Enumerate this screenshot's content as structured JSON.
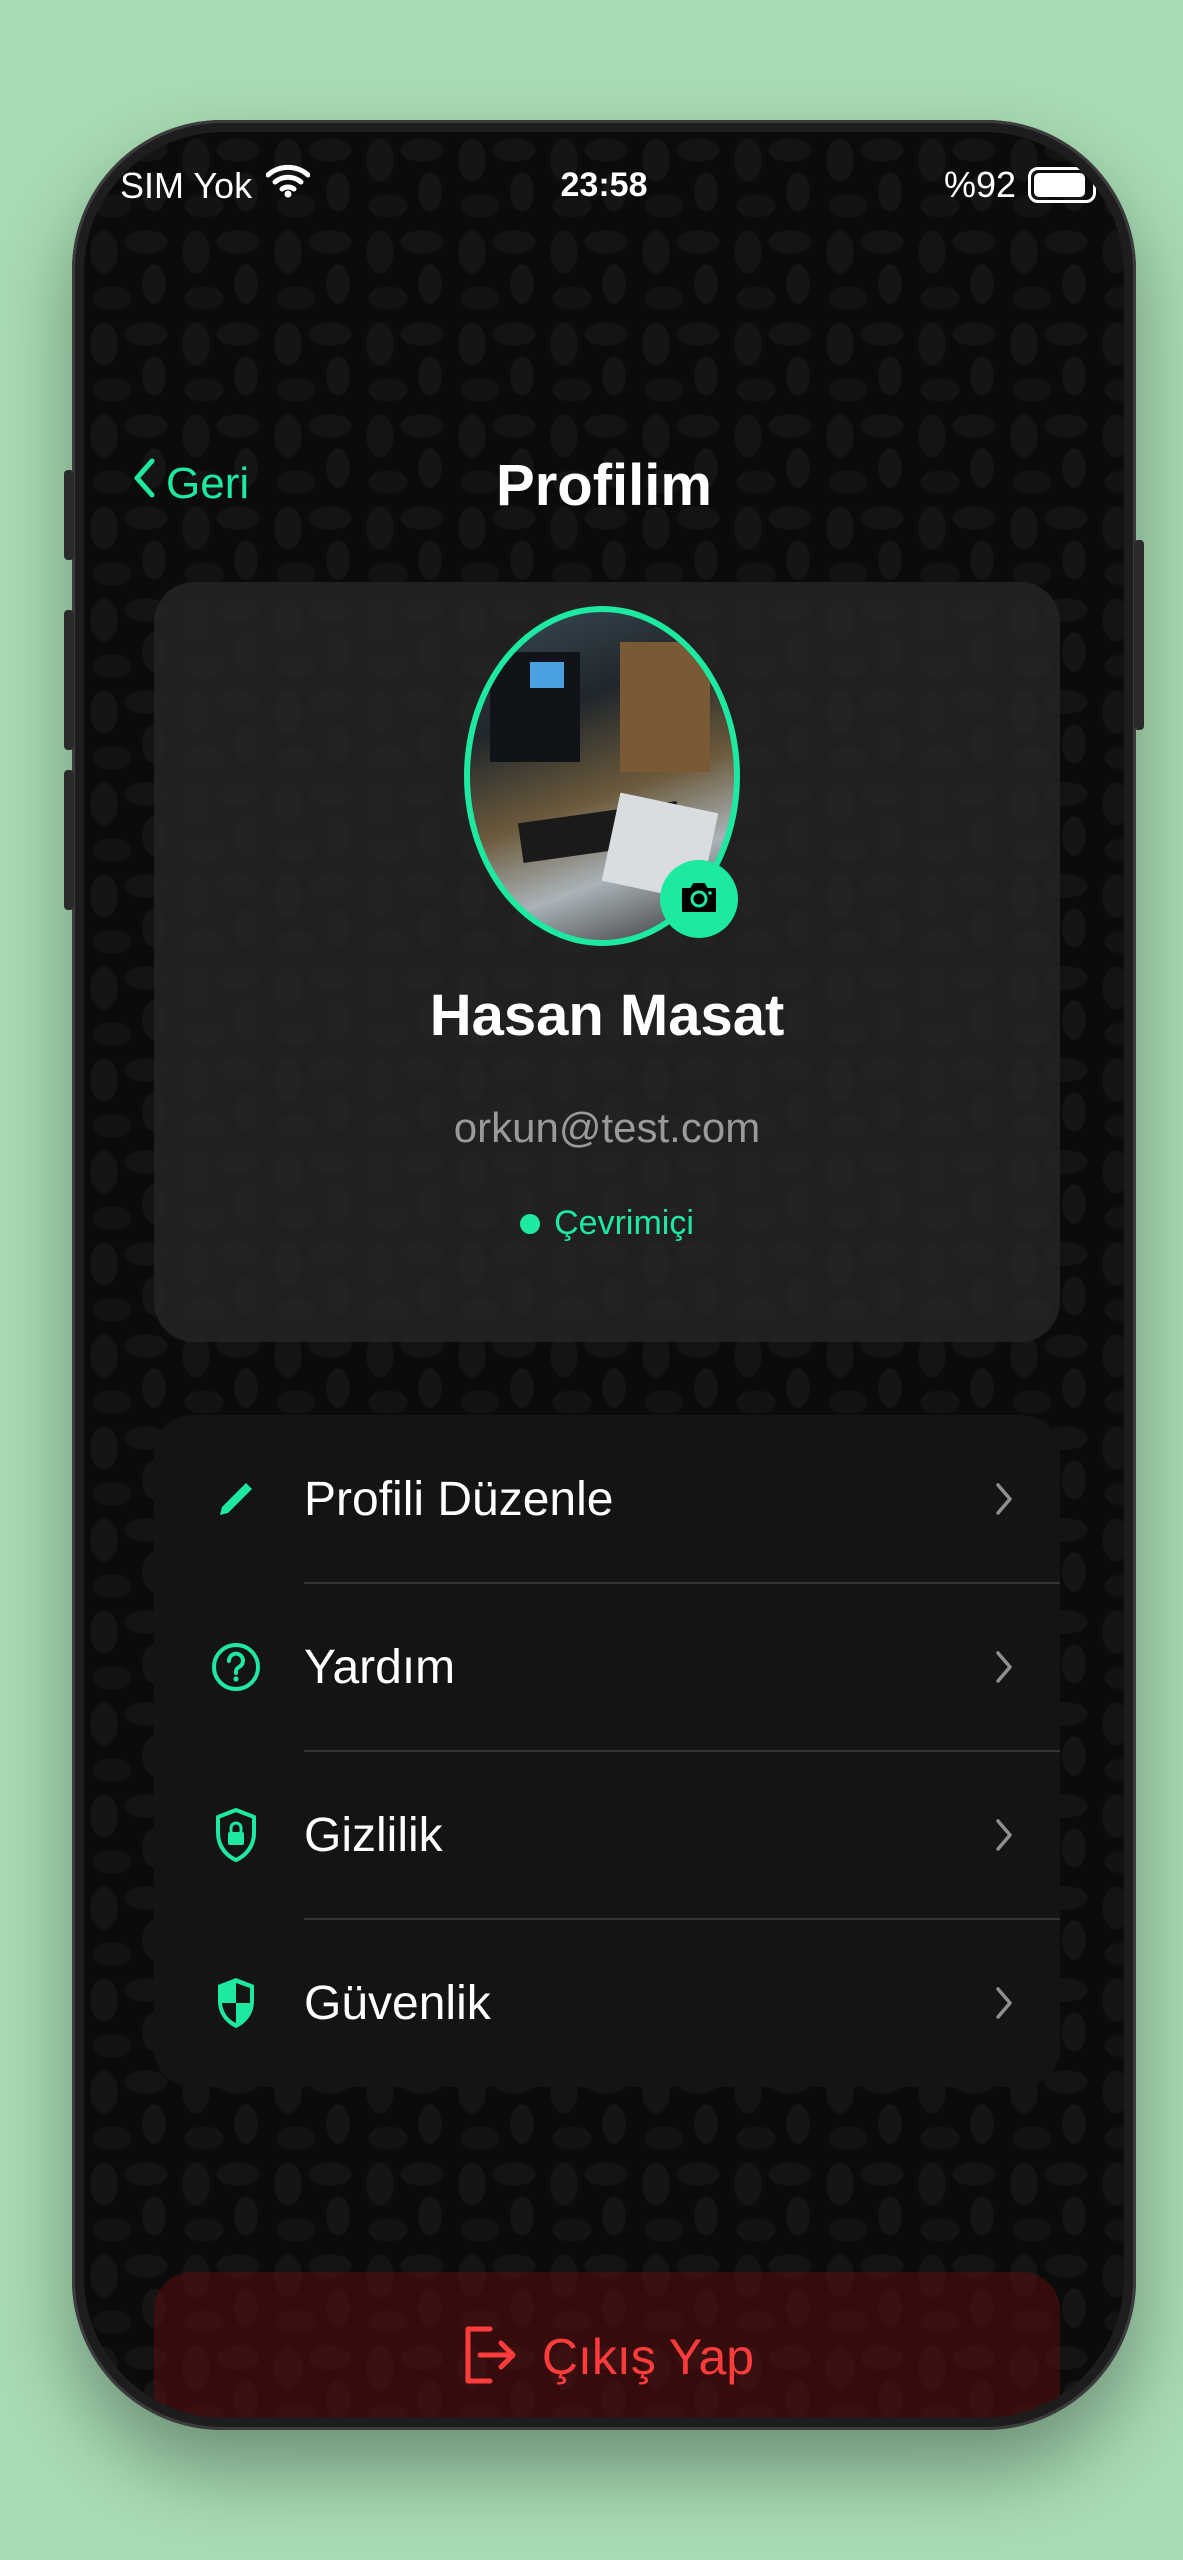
{
  "status_bar": {
    "carrier": "SIM Yok",
    "time": "23:58",
    "battery": "%92",
    "battery_level": 0.92
  },
  "nav": {
    "back_label": "Geri",
    "title": "Profilim"
  },
  "profile": {
    "name": "Hasan Masat",
    "email": "orkun@test.com",
    "status": "Çevrimiçi"
  },
  "menu": {
    "items": [
      {
        "label": "Profili Düzenle",
        "icon": "pencil-icon"
      },
      {
        "label": "Yardım",
        "icon": "help-circle-icon"
      },
      {
        "label": "Gizlilik",
        "icon": "lock-shield-icon"
      },
      {
        "label": "Güvenlik",
        "icon": "shield-icon"
      }
    ]
  },
  "logout": {
    "label": "Çıkış Yap"
  },
  "colors": {
    "accent": "#1de9a0",
    "danger": "#ff3b3b",
    "background": "#a8dcb4"
  }
}
